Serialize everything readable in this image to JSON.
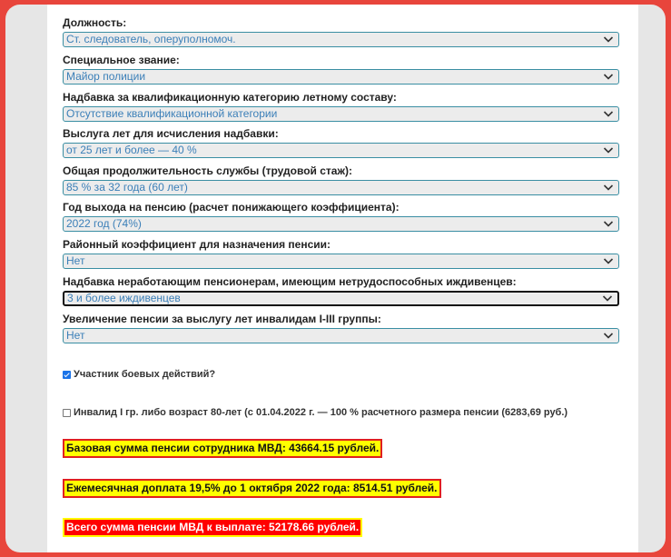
{
  "fields": [
    {
      "label": "Должность:",
      "value": "Ст. следователь, оперуполномоч."
    },
    {
      "label": "Специальное звание:",
      "value": "Майор полиции"
    },
    {
      "label": "Надбавка за квалификационную категорию летному составу:",
      "value": "Отсутствие квалификационной категории"
    },
    {
      "label": "Выслуга лет для исчисления надбавки:",
      "value": "от 25 лет и более — 40 %"
    },
    {
      "label": "Общая продолжительность службы (трудовой стаж):",
      "value": "85 % за 32 года (60 лет)"
    },
    {
      "label": "Год выхода на пенсию (расчет понижающего коэффициента):",
      "value": "2022 год (74%)"
    },
    {
      "label": "Районный коэффициент для назначения пенсии:",
      "value": "Нет"
    },
    {
      "label": "Надбавка неработающим пенсионерам, имеющим нетрудоспособных иждивенцев:",
      "value": "3 и более иждивенцев"
    },
    {
      "label": "Увеличение пенсии за выслугу лет инвалидам I-III группы:",
      "value": "Нет"
    }
  ],
  "checkboxes": [
    {
      "label": "Участник боевых действий?",
      "checked": true
    },
    {
      "label": "Инвалид I гр. либо возраст 80-лет (с 01.04.2022 г. — 100 % расчетного размера пенсии (6283,69 руб.)",
      "checked": false
    }
  ],
  "results": {
    "base": "Базовая сумма пенсии сотрудника МВД:   43664.15 рублей.",
    "extra": "Ежемесячная доплата 19,5% до 1 октября 2022 года:   8514.51 рублей.",
    "total": "Всего сумма пенсии МВД к выплате:   52178.66 рублей."
  },
  "icons": {
    "select_arrow": "chevron-down-icon",
    "checkbox_checked": "checkmark-icon"
  },
  "colors": {
    "frame": "#e8453c",
    "select_text": "#3b7fb8",
    "select_border": "#3a8ea3",
    "highlight_yellow": "#ffff00",
    "highlight_red": "#ff0000"
  }
}
